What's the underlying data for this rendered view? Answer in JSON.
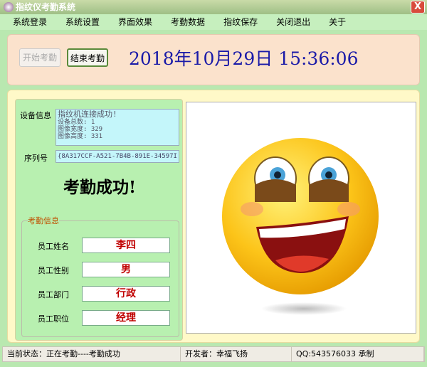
{
  "window": {
    "title": "指纹仪考勤系统",
    "close": "X"
  },
  "menu": [
    "系统登录",
    "系统设置",
    "界面效果",
    "考勤数据",
    "指纹保存",
    "关闭退出",
    "关于"
  ],
  "toolbar": {
    "start": "开始考勤",
    "stop": "结束考勤",
    "datetime": "2018年10月29日  15:36:06"
  },
  "device": {
    "label": "设备信息",
    "lines": [
      "指纹机连接成功!",
      "设备总数: 1",
      "图像宽度: 329",
      "图像高度: 331"
    ],
    "serial_label": "序列号",
    "serial": "{8A317CCF-A521-7B4B-891E-34597I"
  },
  "result": "考勤成功!",
  "info": {
    "legend": "考勤信息",
    "fields": [
      {
        "label": "员工姓名",
        "value": "李四"
      },
      {
        "label": "员工性别",
        "value": "男"
      },
      {
        "label": "员工部门",
        "value": "行政"
      },
      {
        "label": "员工职位",
        "value": "经理"
      }
    ]
  },
  "status": {
    "state": "当前状态：正在考勤----考勤成功",
    "developer": "开发者：幸福飞扬",
    "qq": "QQ:543576033 承制"
  }
}
